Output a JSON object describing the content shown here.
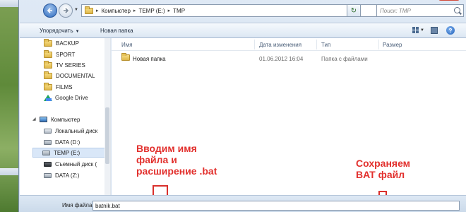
{
  "address": {
    "crumbs": [
      "Компьютер",
      "TEMP (E:)",
      "TMP"
    ],
    "search_placeholder": "Поиск: TMP"
  },
  "toolbar": {
    "organize_label": "Упорядочить",
    "new_folder_label": "Новая папка"
  },
  "nav_pane": {
    "folders": [
      "BACKUP",
      "SPORT",
      "TV SERIES",
      "DOCUMENTAL",
      "FILMS",
      "Google Drive"
    ],
    "computer_label": "Компьютер",
    "drives": [
      "Локальный диск",
      "DATA (D:)",
      "TEMP (E:)",
      "Съемный диск (",
      "DATA (Z:)"
    ],
    "selected_drive": "TEMP (E:)"
  },
  "file_list": {
    "columns": [
      "Имя",
      "Дата изменения",
      "Тип",
      "Размер"
    ],
    "rows": [
      {
        "name": "Новая папка",
        "date": "01.06.2012 16:04",
        "type": "Папка с файлами",
        "size": ""
      }
    ]
  },
  "bottom": {
    "filename_label": "Имя файла:",
    "filename_value": "batnik.bat"
  },
  "annotations": {
    "left_line1": "Вводим имя",
    "left_line2": "файла и",
    "left_line3": "расширение .bat",
    "right_line1": "Сохраняем",
    "right_line2": "BAT файл",
    "color": "#e2302d"
  }
}
